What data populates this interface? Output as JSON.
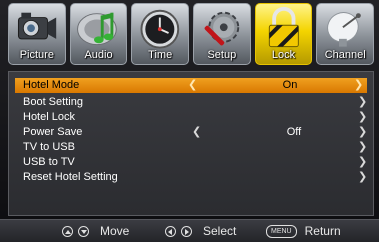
{
  "tabs": [
    {
      "label": "Picture",
      "icon": "camera-icon",
      "active": false
    },
    {
      "label": "Audio",
      "icon": "music-note-icon",
      "active": false
    },
    {
      "label": "Time",
      "icon": "clock-icon",
      "active": false
    },
    {
      "label": "Setup",
      "icon": "gear-wrench-icon",
      "active": false
    },
    {
      "label": "Lock",
      "icon": "padlock-icon",
      "active": true
    },
    {
      "label": "Channel",
      "icon": "satellite-dish-icon",
      "active": false
    }
  ],
  "menu": {
    "items": [
      {
        "label": "Hotel Mode",
        "value": "On",
        "selected": true
      },
      {
        "label": "Boot Setting",
        "value": ""
      },
      {
        "label": "Hotel Lock",
        "value": ""
      },
      {
        "label": "Power Save",
        "value": "Off"
      },
      {
        "label": "TV to USB",
        "value": ""
      },
      {
        "label": "USB to TV",
        "value": ""
      },
      {
        "label": "Reset Hotel Setting",
        "value": ""
      }
    ]
  },
  "footer": {
    "move_label": "Move",
    "select_label": "Select",
    "menu_key": "MENU",
    "return_label": "Return"
  },
  "colors": {
    "selected_row": "#e88a10",
    "active_tab": "#f4d400"
  }
}
